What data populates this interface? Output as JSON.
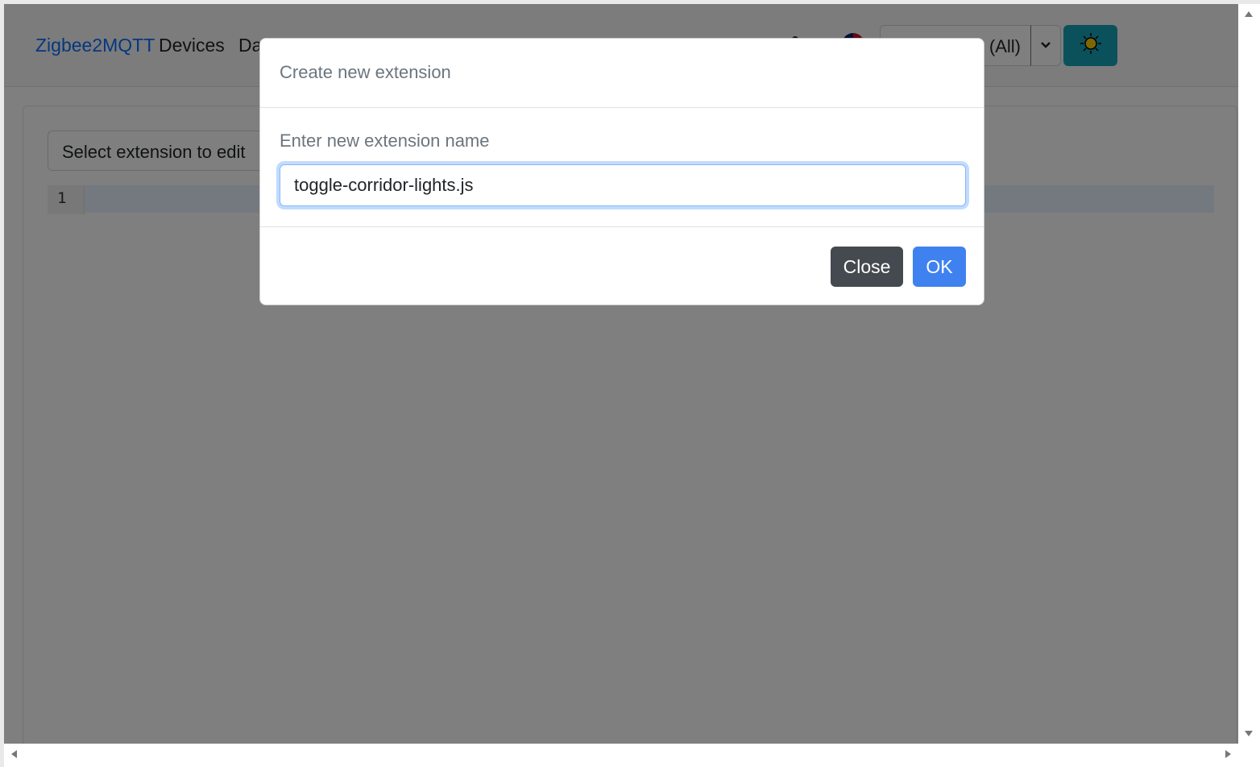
{
  "navbar": {
    "brand": "Zigbee2MQTT",
    "links": {
      "devices": "Devices",
      "dashboard_partial": "Da"
    },
    "permit_join_select_visible": "(All)"
  },
  "main": {
    "extension_select_placeholder": "Select extension to edit",
    "editor": {
      "line_number": "1"
    }
  },
  "modal": {
    "title": "Create new extension",
    "label": "Enter new extension name",
    "input_value": "toggle-corridor-lights.js",
    "close_label": "Close",
    "ok_label": "OK"
  },
  "icons": {
    "user": "user-icon",
    "language": "uk-flag-icon",
    "dropdown": "chevron-down-icon",
    "theme": "sun-icon"
  },
  "colors": {
    "brand": "#0d6efd",
    "ok_button": "#3f82ef",
    "close_button": "#454a50",
    "theme_button": "#17a2b8"
  }
}
